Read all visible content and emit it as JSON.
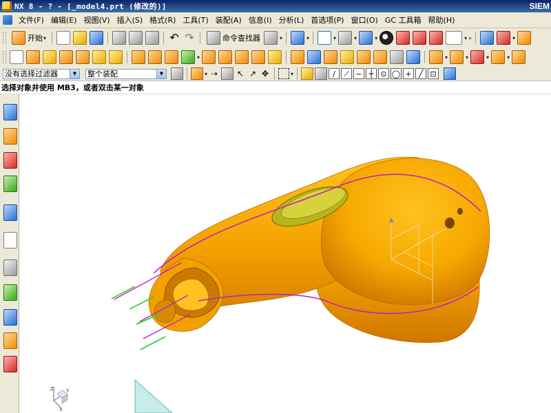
{
  "window": {
    "title": "NX 8 - ? - [_model4.prt (修改的)]",
    "brand": "SIEM"
  },
  "menubar": {
    "items": [
      "文件(F)",
      "编辑(E)",
      "视图(V)",
      "插入(S)",
      "格式(R)",
      "工具(T)",
      "装配(A)",
      "信息(I)",
      "分析(L)",
      "首选项(P)",
      "窗口(O)",
      "GC 工具箱",
      "帮助(H)"
    ]
  },
  "toolbar1": {
    "start_label": "开始",
    "command_finder_label": "命令查找器"
  },
  "selection_bar": {
    "filter_value": "没有选择过滤器",
    "scope_value": "整个装配"
  },
  "status": {
    "message": "选择对象并使用 MB3，或者双击某一对象"
  },
  "triad": {
    "z": "Z",
    "y": "Y",
    "x": "X"
  },
  "icons": {
    "resource_bar": [
      "assembly-navigator-icon",
      "constraint-navigator-icon",
      "part-navigator-icon",
      "reuse-library-icon",
      "internet-explorer-icon",
      "history-icon",
      "system-materials-icon",
      "process-studio-icon",
      "roles-icon",
      "system-scene-icon"
    ]
  },
  "colors": {
    "model": "#f6a800",
    "model_edge": "#d17a00",
    "spline_magenta": "#c21ac0",
    "spline_green": "#2bd12b",
    "face_olive": "#b7b51c"
  }
}
